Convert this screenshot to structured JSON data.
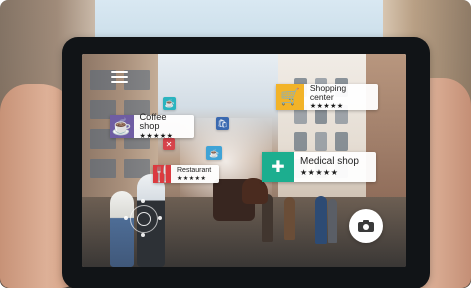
{
  "overlay": {
    "pois": [
      {
        "label": "Coffee shop",
        "rating": "★★★★★",
        "color": "#6f5da3",
        "icon": "coffee-cup-icon"
      },
      {
        "label": "Shopping center",
        "rating": "★★★★★",
        "color": "#f2b328",
        "icon": "shopping-cart-icon"
      },
      {
        "label": "Restaurant",
        "rating": "★★★★★",
        "color": "#db3a3f",
        "icon": "fork-knife-icon"
      },
      {
        "label": "Medical shop",
        "rating": "★★★★★",
        "color": "#1cae8f",
        "icon": "medical-cross-icon"
      }
    ],
    "accent_icons": [
      "cup-icon",
      "shopping-bag-icon",
      "coffee-cup-icon",
      "restaurant-icon"
    ],
    "menu_icon": "menu-icon",
    "camera_icon": "camera-icon"
  }
}
